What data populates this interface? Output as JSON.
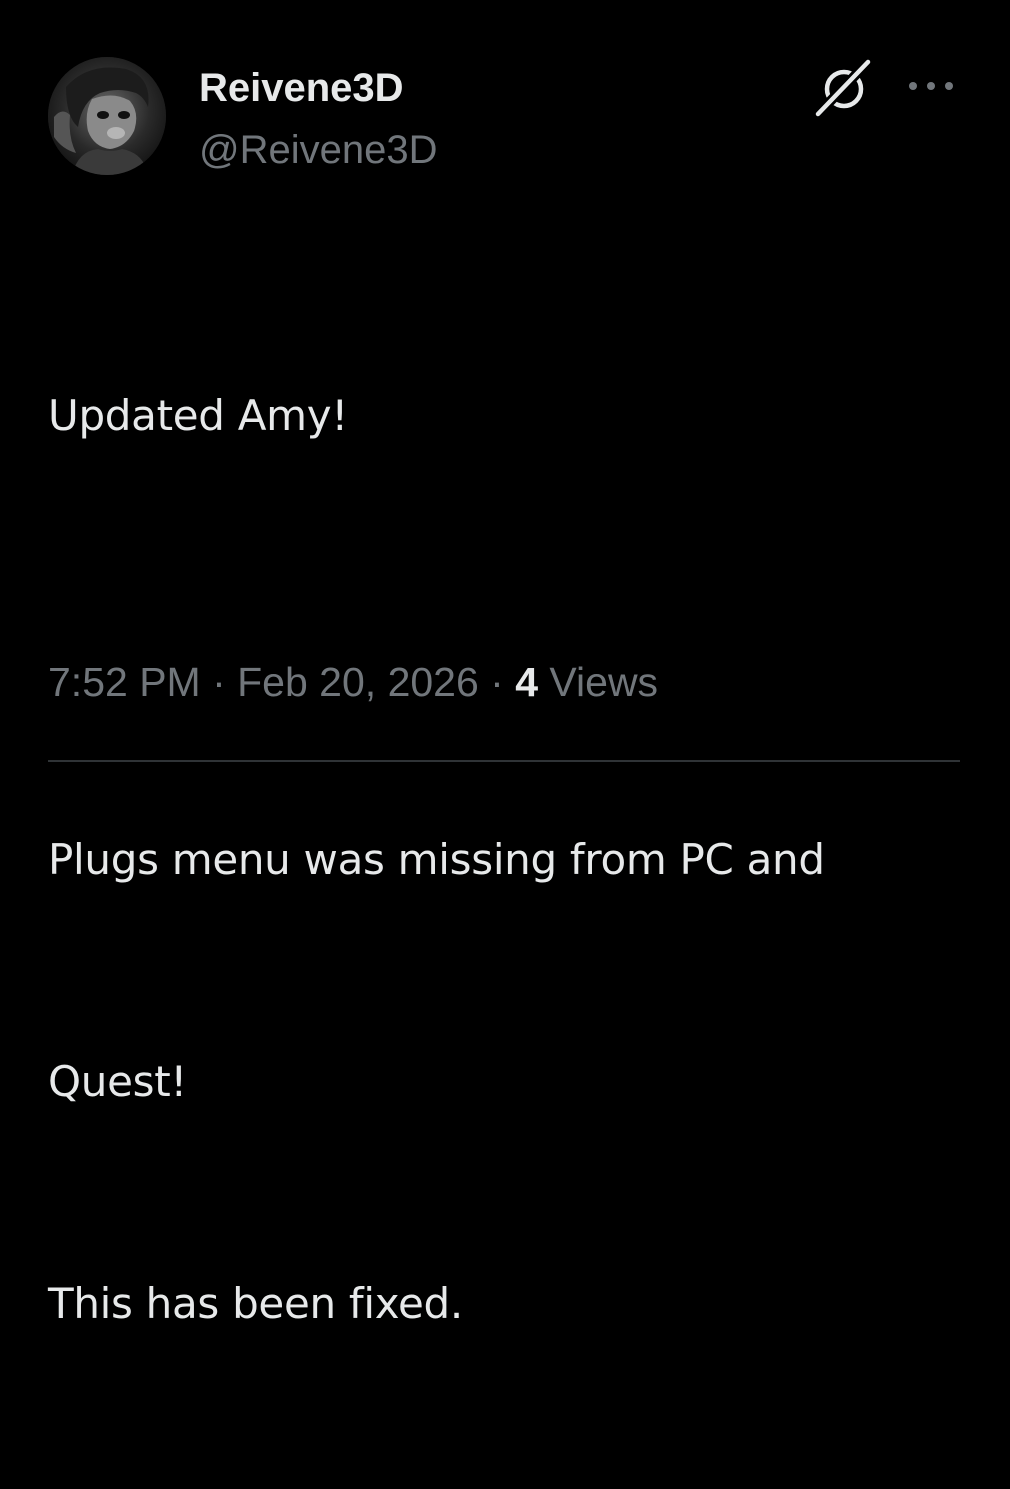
{
  "tweet": {
    "author": {
      "display_name": "Reivene3D",
      "handle": "@Reivene3D",
      "avatar_icon": "avatar-image"
    },
    "actions": {
      "grok_icon": "grok-icon",
      "more_icon": "more-options-icon"
    },
    "text_lines": [
      "Updated Amy!",
      "",
      "Plugs menu was missing from PC and",
      "Quest!",
      "This has been fixed."
    ],
    "meta": {
      "time": "7:52 PM",
      "separator": " · ",
      "date": "Feb 20, 2026",
      "views_count": "4",
      "views_label": " Views"
    }
  },
  "colors": {
    "background": "#000000",
    "primary_text": "#e7e9ea",
    "secondary_text": "#71767b",
    "divider": "#2f3336"
  }
}
